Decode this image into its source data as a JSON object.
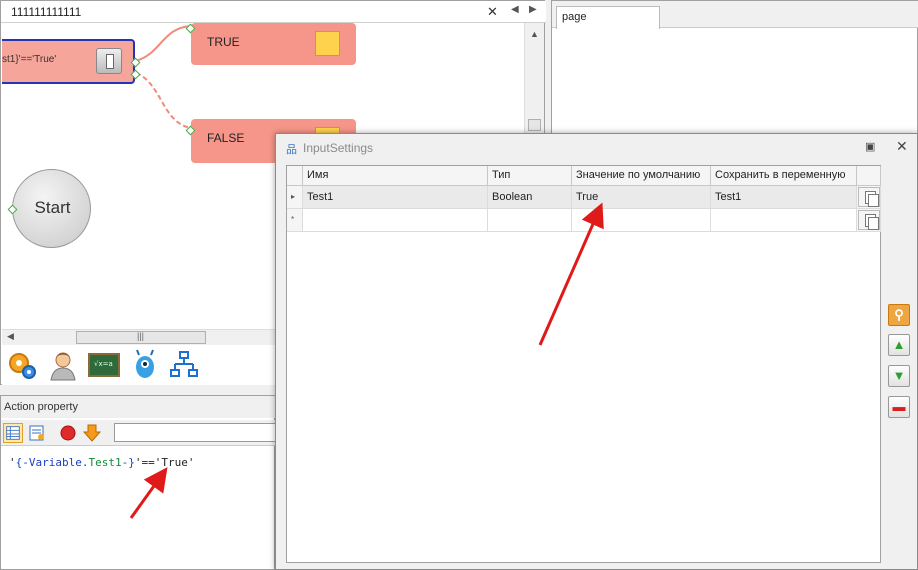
{
  "designer": {
    "tab_title": "111111111111",
    "condition_text": "st1}'=='True'",
    "true_label": "TRUE",
    "false_label": "FALSE",
    "start_label": "Start"
  },
  "action_property": {
    "title": "Action property",
    "code": {
      "q1": "'",
      "var": "{-Variable.",
      "name": "Test1",
      "close": "-}",
      "rest": "'=='True'"
    }
  },
  "page_pane": {
    "tab_label": "page"
  },
  "input_settings": {
    "title": "InputSettings",
    "columns": [
      "Имя",
      "Тип",
      "Значение по умолчанию",
      "Сохранить в переменную"
    ],
    "rows": [
      [
        "Test1",
        "Boolean",
        "True",
        "Test1"
      ]
    ],
    "new_row_marker": "*",
    "current_row_marker": "▸"
  },
  "icons": {
    "toolbar": [
      "settings-gears-icon",
      "user-icon",
      "formula-board-icon",
      "robot-icon",
      "hierarchy-icon"
    ],
    "side": [
      "search-icon",
      "arrow-up-icon",
      "arrow-down-icon",
      "remove-icon"
    ]
  },
  "colors": {
    "node_fill": "#f6968a",
    "selection_border": "#2334b8",
    "annotation_arrow": "#e01919"
  }
}
